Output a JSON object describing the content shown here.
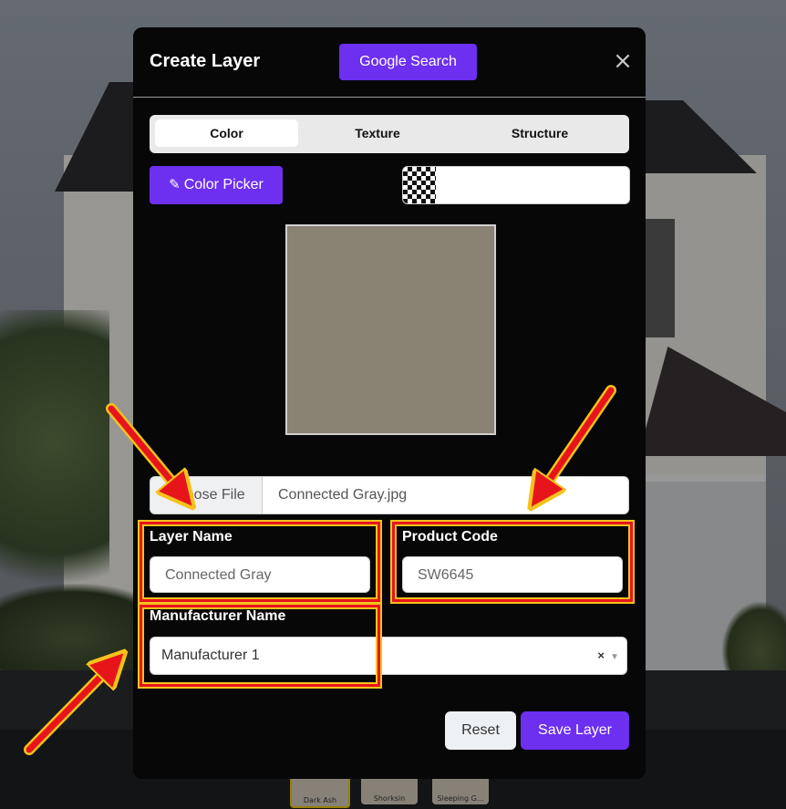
{
  "modal": {
    "title": "Create Layer",
    "google_search_label": "Google Search",
    "close_label": "×"
  },
  "tabs": [
    {
      "label": "Color",
      "active": true
    },
    {
      "label": "Texture",
      "active": false
    },
    {
      "label": "Structure",
      "active": false
    }
  ],
  "color_picker": {
    "button_label": "Color Picker",
    "icon": "pencil-icon",
    "swatch_color": "#8a8272"
  },
  "file": {
    "button_label": "Choose File",
    "file_name": "Connected Gray.jpg"
  },
  "layer_name": {
    "label": "Layer Name",
    "value": "Connected Gray"
  },
  "product_code": {
    "label": "Product Code",
    "value": "SW6645"
  },
  "manufacturer": {
    "label": "Manufacturer Name",
    "value": "Manufacturer 1",
    "clear_label": "×",
    "chevron_icon": "chevron-down-icon"
  },
  "actions": {
    "reset_label": "Reset",
    "save_label": "Save Layer"
  },
  "thumbnails": [
    {
      "label": "Dark Ash"
    },
    {
      "label": "Shorksin"
    },
    {
      "label": "Sleeping G..."
    }
  ],
  "colors": {
    "accent": "#6d2ff0",
    "annotation_red": "#e8141c",
    "annotation_yellow": "#f4c21c"
  }
}
